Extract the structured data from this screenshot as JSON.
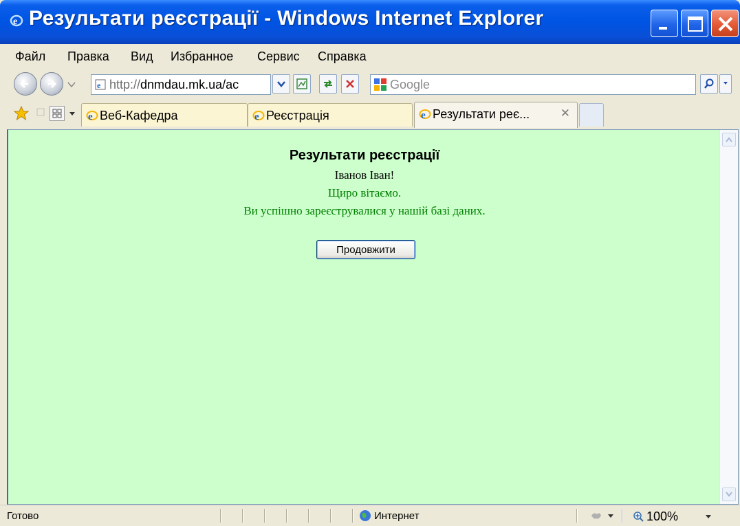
{
  "window": {
    "title": "Результати реєстрації - Windows Internet Explorer",
    "colors": {
      "titlebar": "#0054E3",
      "content_bg": "#CCFFCC",
      "message_green": "#008000"
    }
  },
  "menu": {
    "items": [
      "Файл",
      "Правка",
      "Вид",
      "Избранное",
      "Сервис",
      "Справка"
    ]
  },
  "address": {
    "protocol": "http://",
    "host": "dnmdau.mk.ua/ac"
  },
  "search": {
    "placeholder": "Google"
  },
  "tabs": [
    {
      "label": "Веб-Кафедра",
      "active": false
    },
    {
      "label": "Реєстрація",
      "active": false
    },
    {
      "label": "Результати реє...",
      "active": true
    }
  ],
  "page": {
    "heading": "Результати реєстрації",
    "name_line": "Іванов Іван!",
    "greeting": "Щиро вітаємо.",
    "message": "Ви успішно зареєструвалися у нашій базі даних.",
    "continue_button": "Продовжити"
  },
  "status": {
    "text": "Готово",
    "zone": "Интернет",
    "zoom": "100%"
  },
  "icons": [
    "ie-logo-icon",
    "minimize-icon",
    "maximize-icon",
    "close-icon",
    "back-icon",
    "forward-icon",
    "refresh-icon",
    "stop-icon",
    "favorites-star-icon",
    "quick-tabs-icon",
    "search-go-icon",
    "globe-icon",
    "zoom-icon"
  ]
}
